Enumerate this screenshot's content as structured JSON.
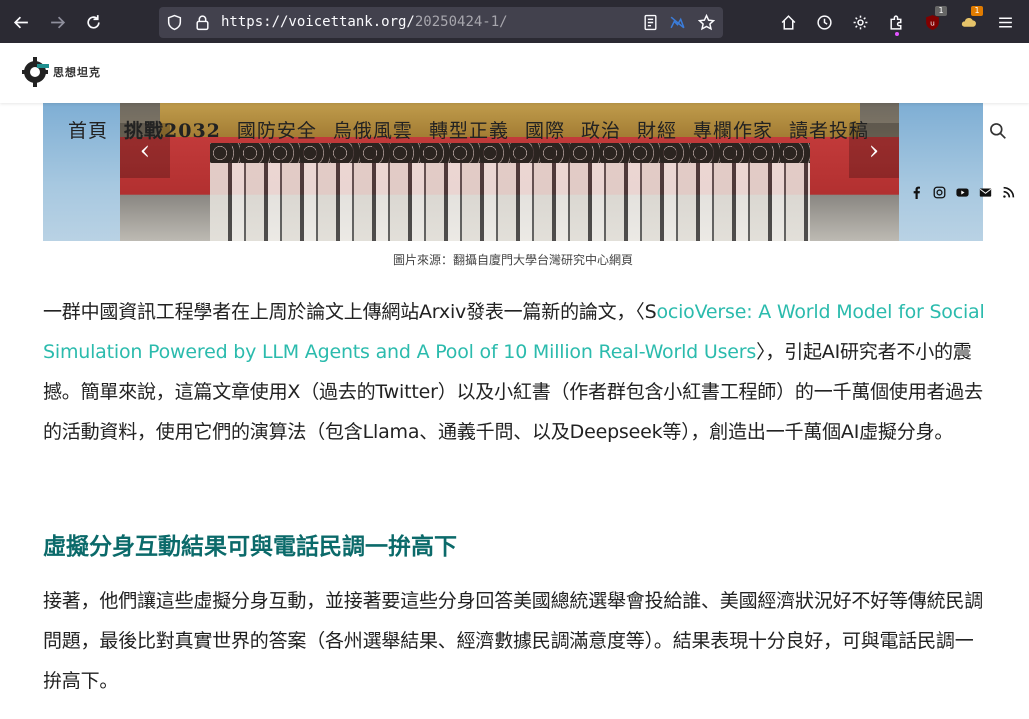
{
  "browser": {
    "url_host": "https://voicettank.org/",
    "url_path": "20250424-1/",
    "extension_badges": {
      "ublock": "1",
      "other": "1"
    },
    "colors": {
      "toolbar": "#2b2a33",
      "urlbar": "#42414d",
      "text": "#fbfbfe"
    }
  },
  "site": {
    "logo_text": "思想坦克",
    "nav": [
      "首頁",
      "挑戰2032",
      "國防安全",
      "烏俄風雲",
      "轉型正義",
      "國際",
      "政治",
      "財經",
      "專欄作家",
      "讀者投稿"
    ]
  },
  "hero": {
    "caption": "圖片來源：翻攝自廈門大學台灣研究中心網頁",
    "prev_label": "‹",
    "next_label": "›"
  },
  "article": {
    "p1_lead": "一群中國資訊工程學者在上周於論文上傳網站Arxiv發表一篇新的論文，〈S",
    "p1_link": "ocioVerse: A World Model for Social Simulation Powered by LLM Agents and A Pool of 10 Million Real-World Users",
    "p1_rest": "〉，引起AI研究者不小的震撼。簡單來說，這篇文章使用X（過去的Twitter）以及小紅書（作者群包含小紅書工程師）的一千萬個使用者過去的活動資料，使用它們的演算法（包含Llama、通義千問、以及Deepseek等），創造出一千萬個AI虛擬分身。",
    "subheading": "虛擬分身互動結果可與電話民調一拚高下",
    "p2": "接著，他們讓這些虛擬分身互動，並接著要這些分身回答美國總統選舉會投給誰、美國經濟狀況好不好等傳統民調問題，最後比對真實世界的答案（各州選舉結果、經濟數據民調滿意度等）。結果表現十分良好，可與電話民調一拚高下。",
    "colors": {
      "link": "#2bbbad",
      "subheading": "#0b6a6a",
      "text": "#222222"
    }
  }
}
